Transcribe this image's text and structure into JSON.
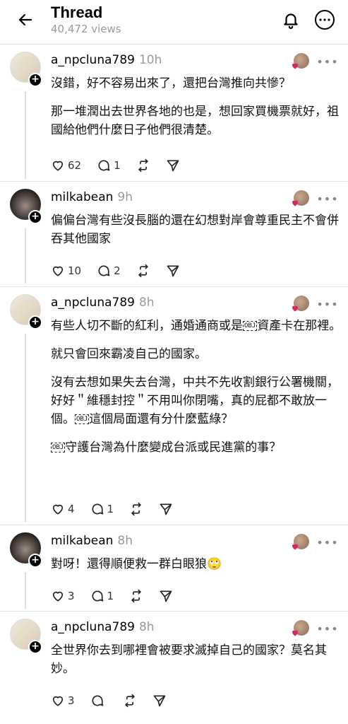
{
  "header": {
    "title": "Thread",
    "views": "40,472 views"
  },
  "posts": [
    {
      "username": "a_npcluna789",
      "time": "10h",
      "paragraphs": [
        "沒錯，好不容易出來了，還把台灣推向共慘？",
        "那一堆潤出去世界各地的也是，想回家買機票就好，祖國給他們什麼日子他們很清楚。"
      ],
      "likes": "62",
      "replies": "1"
    },
    {
      "username": "milkabean",
      "time": "9h",
      "paragraphs": [
        "偏偏台灣有些沒長腦的還在幻想對岸會尊重民主不會併吞其他國家"
      ],
      "likes": "10",
      "replies": "2"
    },
    {
      "username": "a_npcluna789",
      "time": "8h",
      "p1a": "有些人切不斷的紅利，通婚通商或是",
      "p1b": "資產卡在那裡。",
      "p2": "就只會回來霸凌自己的國家。",
      "p3a": "沒有去想如果失去台灣，中共不先收割銀行公署機關，好好＂維穩封控＂不用叫你閉嘴，真的屁都不敢放一個。",
      "p3b": "這個局面還有分什麼藍綠？",
      "p4": "守護台灣為什麼變成台派或民進黨的事？",
      "obj": "OBJ",
      "likes": "4",
      "replies": "1"
    },
    {
      "username": "milkabean",
      "time": "8h",
      "paragraphs": [
        "對呀！還得順便救一群白眼狼🙄"
      ],
      "likes": "3",
      "replies": "1"
    },
    {
      "username": "a_npcluna789",
      "time": "8h",
      "paragraphs": [
        "全世界你去到哪裡會被要求滅掉自己的國家？莫名其妙。"
      ],
      "likes": "3",
      "replies": ""
    }
  ],
  "icons": {
    "back": "arrow-left-icon",
    "bell": "bell-icon",
    "more": "more-horizontal-icon",
    "like": "heart-icon",
    "reply": "comment-icon",
    "repost": "repost-icon",
    "share": "send-icon"
  },
  "colors": {
    "like_badge": "#e0245e",
    "muted_text": "#999999"
  }
}
